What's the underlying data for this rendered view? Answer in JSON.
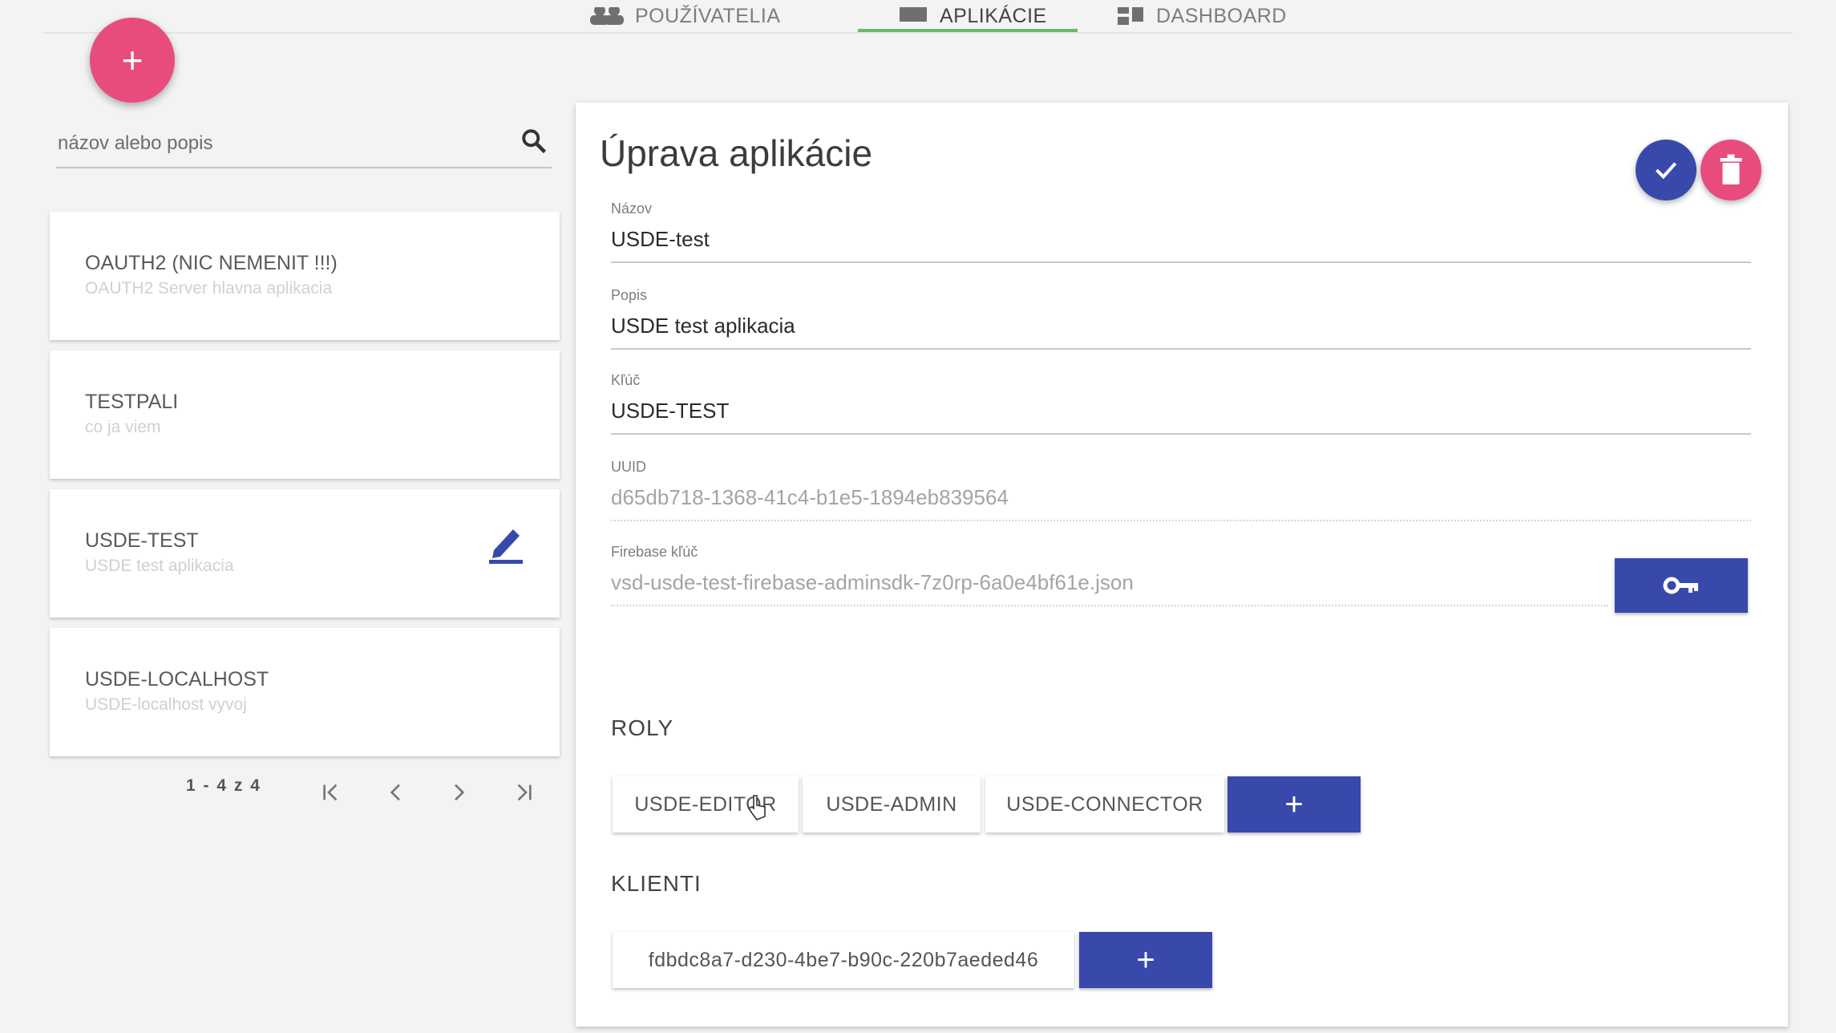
{
  "tabs": [
    {
      "label": "POUŽÍVATELIA",
      "icon": "people-icon"
    },
    {
      "label": "APLIKÁCIE",
      "icon": "laptop-icon",
      "active": true
    },
    {
      "label": "DASHBOARD",
      "icon": "dashboard-icon"
    }
  ],
  "fab": {
    "label": "+"
  },
  "search": {
    "placeholder": "názov alebo popis"
  },
  "apps": [
    {
      "title": "OAUTH2 (NIC NEMENIT !!!)",
      "description": "OAUTH2 Server hlavna aplikacia"
    },
    {
      "title": "TESTPALI",
      "description": "co ja viem"
    },
    {
      "title": "USDE-TEST",
      "description": "USDE test aplikacia",
      "selected": true
    },
    {
      "title": "USDE-LOCALHOST",
      "description": "USDE-localhost vyvoj"
    }
  ],
  "pagination": {
    "range": "1 - 4 z 4"
  },
  "panel": {
    "title": "Úprava aplikácie",
    "fields": {
      "name": {
        "label": "Názov",
        "value": "USDE-test"
      },
      "description": {
        "label": "Popis",
        "value": "USDE test aplikacia"
      },
      "key": {
        "label": "Kľúč",
        "value": "USDE-TEST"
      },
      "uuid": {
        "label": "UUID",
        "value": "d65db718-1368-41c4-b1e5-1894eb839564"
      },
      "firebase": {
        "label": "Firebase kľúč",
        "value": "vsd-usde-test-firebase-adminsdk-7z0rp-6a0e4bf61e.json"
      }
    },
    "roles_title": "ROLY",
    "roles": [
      "USDE-EDITOR",
      "USDE-ADMIN",
      "USDE-CONNECTOR"
    ],
    "clients_title": "KLIENTI",
    "clients": [
      "fdbdc8a7-d230-4be7-b90c-220b7aeded46"
    ],
    "add_label": "+"
  },
  "colors": {
    "primary": "#3949ab",
    "accent": "#e84c7d",
    "tab_indicator": "#66bb6a"
  }
}
